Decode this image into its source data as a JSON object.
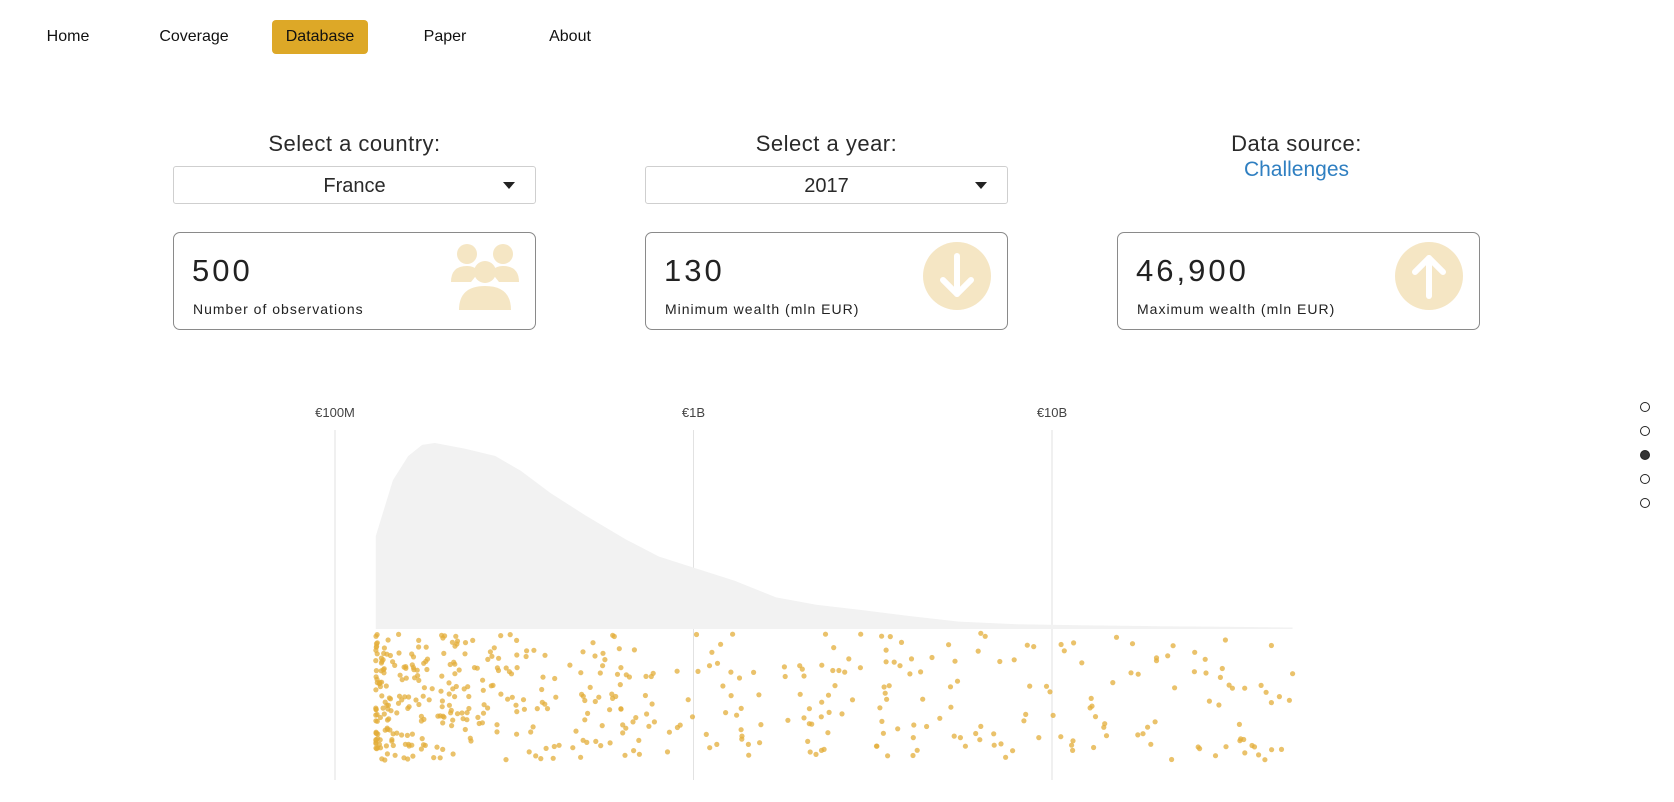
{
  "nav": {
    "items": [
      {
        "label": "Home",
        "active": false
      },
      {
        "label": "Coverage",
        "active": false
      },
      {
        "label": "Database",
        "active": true
      },
      {
        "label": "Paper",
        "active": false
      },
      {
        "label": "About",
        "active": false
      }
    ]
  },
  "controls": {
    "country_label": "Select a country:",
    "country_value": "France",
    "year_label": "Select a year:",
    "year_value": "2017",
    "source_label": "Data source:",
    "source_link": "Challenges"
  },
  "stats": [
    {
      "value": "500",
      "label": "Number of observations",
      "icon": "people-group-icon"
    },
    {
      "value": "130",
      "label": "Minimum wealth (mln EUR)",
      "icon": "arrow-down-circle-icon"
    },
    {
      "value": "46,900",
      "label": "Maximum wealth (mln EUR)",
      "icon": "arrow-up-circle-icon"
    }
  ],
  "colors": {
    "accent": "#DDA827",
    "icon_fill": "#F5E6C4",
    "density_fill": "#F2F2F2",
    "dot": "#E3AE3A",
    "link": "#2f7fc1"
  },
  "section_nav": {
    "count": 5,
    "active_index": 2
  },
  "chart_data": {
    "type": "scatter",
    "subtype": "density-with-jittered-dots",
    "x_scale": "log",
    "x_unit": "EUR",
    "xlim": [
      60000000,
      80000000000
    ],
    "ticks": [
      {
        "value": 100000000,
        "label": "€100M"
      },
      {
        "value": 1000000000,
        "label": "€1B"
      },
      {
        "value": 10000000000,
        "label": "€10B"
      }
    ],
    "n": 500,
    "min_mln": 130,
    "max_mln": 46900,
    "density_curve": [
      [
        130,
        0.5
      ],
      [
        145,
        0.8
      ],
      [
        160,
        0.93
      ],
      [
        175,
        0.99
      ],
      [
        190,
        1.0
      ],
      [
        230,
        0.97
      ],
      [
        280,
        0.93
      ],
      [
        330,
        0.85
      ],
      [
        400,
        0.73
      ],
      [
        500,
        0.61
      ],
      [
        650,
        0.48
      ],
      [
        800,
        0.39
      ],
      [
        1000,
        0.33
      ],
      [
        1300,
        0.26
      ],
      [
        1700,
        0.17
      ],
      [
        2200,
        0.13
      ],
      [
        3000,
        0.1
      ],
      [
        4000,
        0.07
      ],
      [
        5500,
        0.04
      ],
      [
        8000,
        0.025
      ],
      [
        12000,
        0.02
      ],
      [
        20000,
        0.015
      ],
      [
        30000,
        0.012
      ],
      [
        46900,
        0.008
      ]
    ],
    "grid": true,
    "legend": "none"
  }
}
